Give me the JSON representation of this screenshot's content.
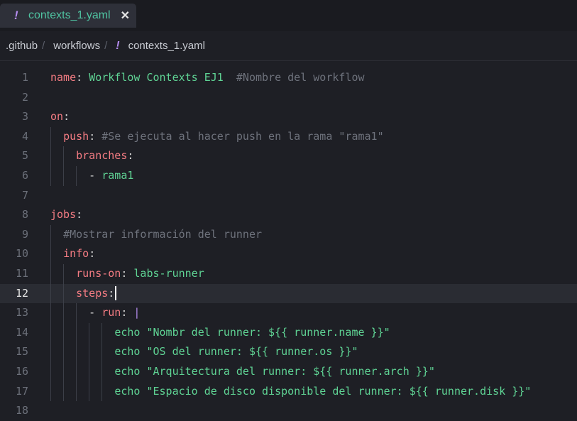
{
  "tab": {
    "icon": "exclamation-icon",
    "label": "contexts_1.yaml",
    "close": "✕"
  },
  "breadcrumb": {
    "items": [
      ".github",
      "workflows",
      "contexts_1.yaml"
    ],
    "separator": "/",
    "icon": "exclamation-icon"
  },
  "editor": {
    "active_line": 12,
    "lines": [
      {
        "n": "1",
        "tokens": [
          {
            "t": "k",
            "v": "name"
          },
          {
            "t": "p",
            "v": ": "
          },
          {
            "t": "s",
            "v": "Workflow Contexts EJ1"
          },
          {
            "t": "p",
            "v": "  "
          },
          {
            "t": "c",
            "v": "#Nombre del workflow"
          }
        ]
      },
      {
        "n": "2",
        "tokens": []
      },
      {
        "n": "3",
        "tokens": [
          {
            "t": "k",
            "v": "on"
          },
          {
            "t": "p",
            "v": ":"
          }
        ]
      },
      {
        "n": "4",
        "tokens": [
          {
            "t": "p",
            "v": "  "
          },
          {
            "t": "k",
            "v": "push"
          },
          {
            "t": "p",
            "v": ": "
          },
          {
            "t": "c",
            "v": "#Se ejecuta al hacer push en la rama \"rama1\""
          }
        ]
      },
      {
        "n": "5",
        "tokens": [
          {
            "t": "p",
            "v": "    "
          },
          {
            "t": "k",
            "v": "branches"
          },
          {
            "t": "p",
            "v": ":"
          }
        ]
      },
      {
        "n": "6",
        "tokens": [
          {
            "t": "p",
            "v": "      - "
          },
          {
            "t": "s",
            "v": "rama1"
          }
        ]
      },
      {
        "n": "7",
        "tokens": []
      },
      {
        "n": "8",
        "tokens": [
          {
            "t": "k",
            "v": "jobs"
          },
          {
            "t": "p",
            "v": ":"
          }
        ]
      },
      {
        "n": "9",
        "tokens": [
          {
            "t": "p",
            "v": "  "
          },
          {
            "t": "c",
            "v": "#Mostrar información del runner"
          }
        ]
      },
      {
        "n": "10",
        "tokens": [
          {
            "t": "p",
            "v": "  "
          },
          {
            "t": "k",
            "v": "info"
          },
          {
            "t": "p",
            "v": ":"
          }
        ]
      },
      {
        "n": "11",
        "tokens": [
          {
            "t": "p",
            "v": "    "
          },
          {
            "t": "k",
            "v": "runs-on"
          },
          {
            "t": "p",
            "v": ": "
          },
          {
            "t": "s",
            "v": "labs-runner"
          }
        ]
      },
      {
        "n": "12",
        "tokens": [
          {
            "t": "p",
            "v": "    "
          },
          {
            "t": "k",
            "v": "steps"
          },
          {
            "t": "p",
            "v": ":"
          }
        ]
      },
      {
        "n": "13",
        "tokens": [
          {
            "t": "p",
            "v": "      - "
          },
          {
            "t": "k",
            "v": "run"
          },
          {
            "t": "p",
            "v": ": "
          },
          {
            "t": "bar",
            "v": "|"
          }
        ]
      },
      {
        "n": "14",
        "tokens": [
          {
            "t": "p",
            "v": "          "
          },
          {
            "t": "s",
            "v": "echo \"Nombr del runner: ${{ runner.name }}\""
          }
        ]
      },
      {
        "n": "15",
        "tokens": [
          {
            "t": "p",
            "v": "          "
          },
          {
            "t": "s",
            "v": "echo \"OS del runner: ${{ runner.os }}\""
          }
        ]
      },
      {
        "n": "16",
        "tokens": [
          {
            "t": "p",
            "v": "          "
          },
          {
            "t": "s",
            "v": "echo \"Arquitectura del runner: ${{ runner.arch }}\""
          }
        ]
      },
      {
        "n": "17",
        "tokens": [
          {
            "t": "p",
            "v": "          "
          },
          {
            "t": "s",
            "v": "echo \"Espacio de disco disponible del runner: ${{ runner.disk }}\""
          }
        ]
      },
      {
        "n": "18",
        "tokens": []
      }
    ]
  }
}
